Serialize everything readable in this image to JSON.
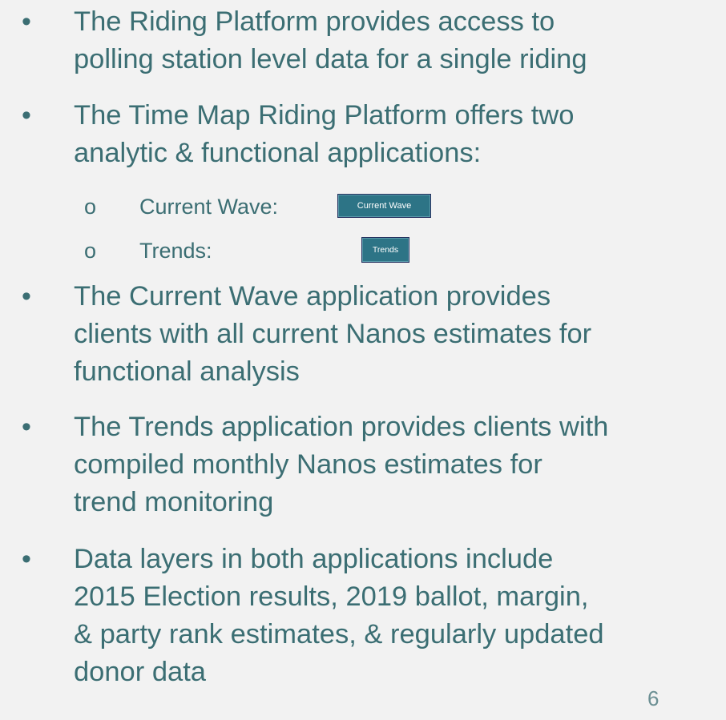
{
  "bullets": [
    {
      "lines": [
        "The Riding Platform provides access to",
        "polling station level data for a single riding"
      ]
    },
    {
      "lines": [
        "The Time Map Riding Platform offers two",
        "analytic & functional applications:"
      ]
    },
    {
      "lines": [
        "The Current Wave application provides",
        "clients with all current Nanos estimates for",
        "functional analysis"
      ]
    },
    {
      "lines": [
        "The Trends application provides clients with",
        "compiled monthly Nanos estimates for",
        "trend monitoring"
      ]
    },
    {
      "lines": [
        "Data layers in both applications include",
        "2015 Election results, 2019 ballot, margin,",
        "& party rank estimates, & regularly updated",
        "donor data"
      ]
    }
  ],
  "bullet_glyph": "•",
  "sub_glyph": "o",
  "sub_items": [
    {
      "label": "Current Wave:",
      "button": "Current Wave"
    },
    {
      "label": "Trends:",
      "button": "Trends"
    }
  ],
  "page_number": "6",
  "colors": {
    "text": "#3b6e73",
    "background": "#f2f2f2",
    "button_fill": "#2d7486",
    "button_border": "#24305e"
  }
}
